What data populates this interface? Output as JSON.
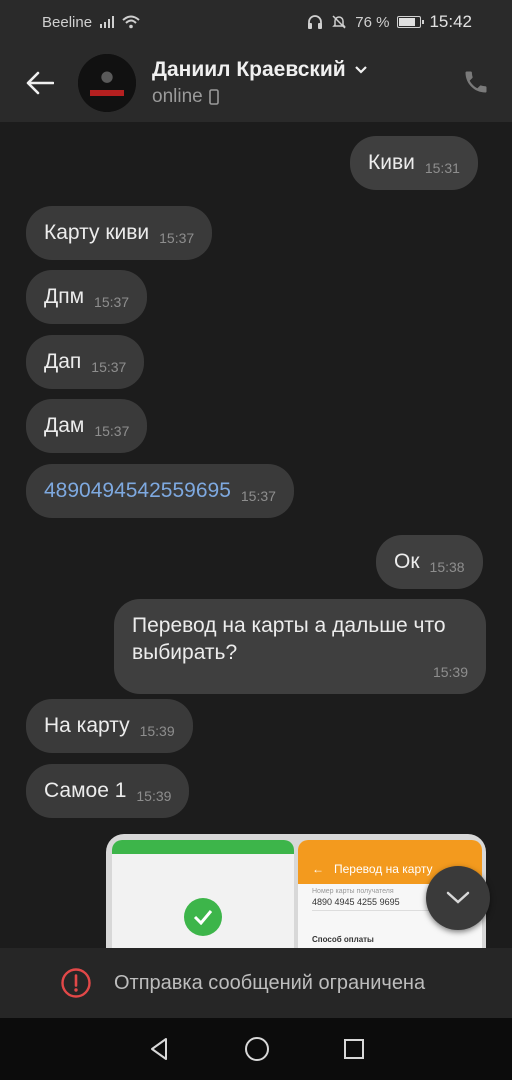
{
  "status_bar": {
    "carrier": "Beeline",
    "battery": "76 %",
    "time": "15:42",
    "battery_level": 0.76
  },
  "header": {
    "name": "Даниил Краевский",
    "status": "online"
  },
  "messages": [
    {
      "direction": "out",
      "text": "Киви",
      "time": "15:31"
    },
    {
      "direction": "in",
      "text": "Карту киви",
      "time": "15:37"
    },
    {
      "direction": "in",
      "text": "Дпм",
      "time": "15:37"
    },
    {
      "direction": "in",
      "text": "Дап",
      "time": "15:37"
    },
    {
      "direction": "in",
      "text": "Дам",
      "time": "15:37"
    },
    {
      "direction": "in",
      "text": "4890494542559695",
      "time": "15:37",
      "is_link": true
    },
    {
      "direction": "out",
      "text": "Ок",
      "time": "15:38"
    },
    {
      "direction": "out",
      "text": "Перевод на карты а дальше что выбирать?",
      "time": "15:39"
    },
    {
      "direction": "in",
      "text": "На карту",
      "time": "15:39"
    },
    {
      "direction": "in",
      "text": "Самое 1",
      "time": "15:39"
    }
  ],
  "image_preview": {
    "right_title": "Перевод на карту",
    "right_field_label": "Номер карты получателя",
    "right_field_value": "4890 4945 4255 9695",
    "right_section": "Способ оплаты"
  },
  "restriction": {
    "text": "Отправка сообщений ограничена"
  }
}
